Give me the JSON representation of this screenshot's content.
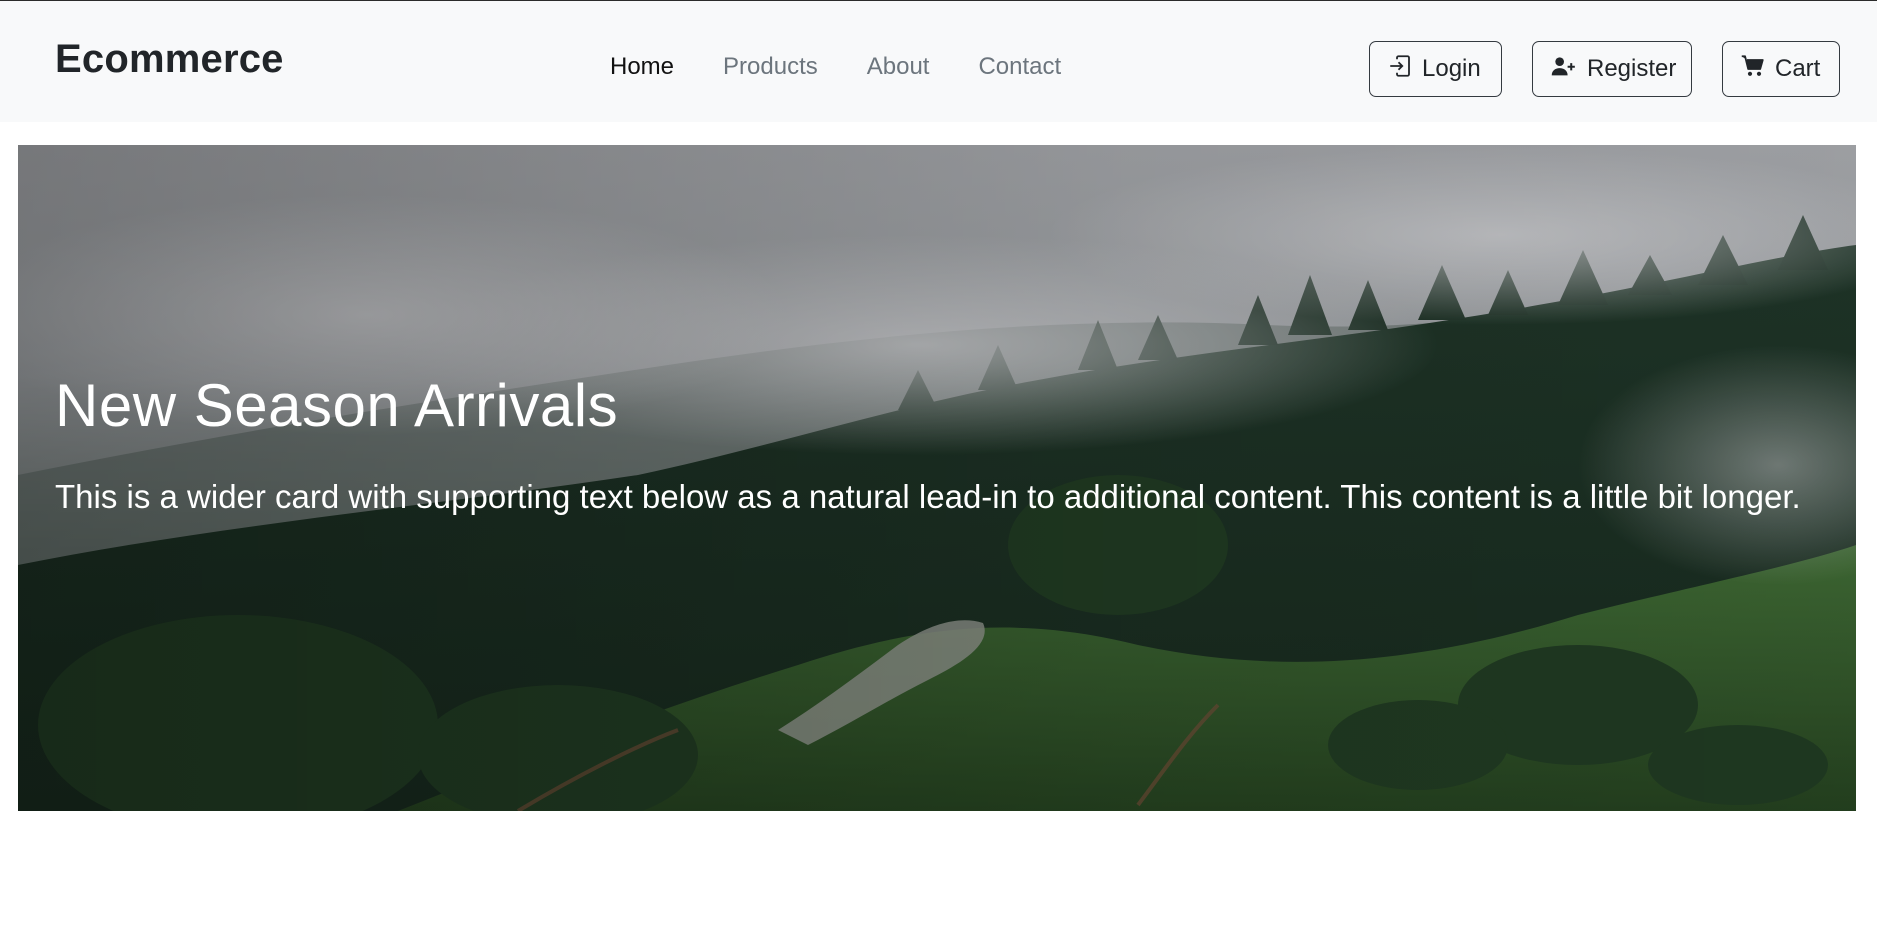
{
  "brand": "Ecommerce",
  "nav": {
    "home": "Home",
    "products": "Products",
    "about": "About",
    "contact": "Contact"
  },
  "actions": {
    "login": "Login",
    "register": "Register",
    "cart": "Cart"
  },
  "hero": {
    "title": "New Season Arrivals",
    "text": "This is a wider card with supporting text below as a natural lead-in to additional content. This content is a little bit longer."
  },
  "colors": {
    "navbar_bg": "#f8f9fa",
    "nav_active": "#111111",
    "nav_muted": "#6c757d",
    "button_border": "#343a40"
  }
}
